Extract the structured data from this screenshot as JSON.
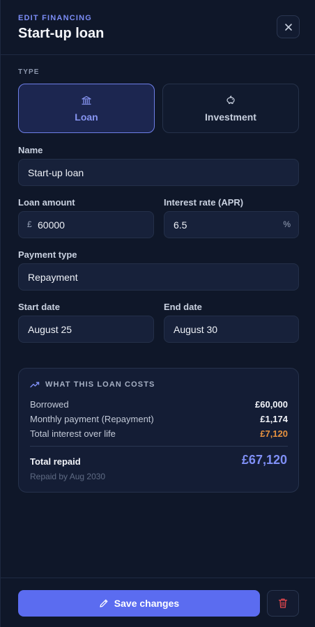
{
  "header": {
    "eyebrow": "EDIT FINANCING",
    "title": "Start-up loan",
    "close_icon": "close-icon"
  },
  "type_section": {
    "label": "TYPE",
    "options": [
      {
        "label": "Loan",
        "icon": "bank-icon",
        "selected": true
      },
      {
        "label": "Investment",
        "icon": "piggy-bank-icon",
        "selected": false
      }
    ]
  },
  "form": {
    "name": {
      "label": "Name",
      "value": "Start-up loan"
    },
    "loan_amount": {
      "label": "Loan amount",
      "prefix": "£",
      "value": "60000"
    },
    "interest_rate": {
      "label": "Interest rate (APR)",
      "value": "6.5",
      "suffix": "%"
    },
    "payment_type": {
      "label": "Payment type",
      "value": "Repayment"
    },
    "start_date": {
      "label": "Start date",
      "value": "August 25"
    },
    "end_date": {
      "label": "End date",
      "value": "August 30"
    }
  },
  "summary": {
    "title": "WHAT THIS LOAN COSTS",
    "icon": "trending-up-icon",
    "rows": [
      {
        "key": "Borrowed",
        "value": "£60,000"
      },
      {
        "key": "Monthly payment (Repayment)",
        "value": "£1,174"
      },
      {
        "key": "Total interest over life",
        "value": "£7,120"
      }
    ],
    "total_label": "Total repaid",
    "total_value": "£67,120",
    "repaid_by": "Repaid by Aug 2030"
  },
  "footer": {
    "save_label": "Save changes",
    "save_icon": "pencil-icon",
    "delete_icon": "trash-icon"
  },
  "colors": {
    "background": "#0f1729",
    "accent": "#5b6cf0",
    "accent_text": "#7f8ff5",
    "warning": "#e8923f",
    "danger": "#e5484d"
  }
}
